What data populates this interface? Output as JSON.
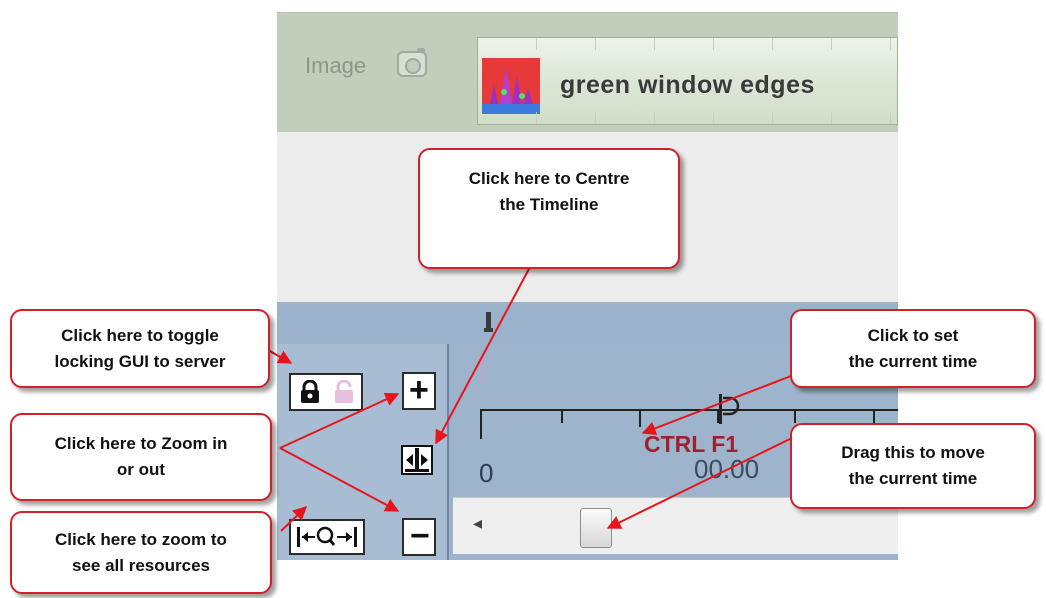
{
  "track": {
    "label": "Image",
    "camera_icon": "camera-icon",
    "clip_title": "green window edges"
  },
  "timeline": {
    "zero_label": "0",
    "current_time_label": "CTRL F1",
    "timecode": "00.00"
  },
  "controls": {
    "lock_icon": "padlock-icon",
    "unlock_icon": "unlocked-padlock-icon",
    "zoom_in_symbol": "+",
    "zoom_out_symbol": "−",
    "centre_icon": "centre-timeline-icon",
    "zoom_all_icon": "zoom-all-icon",
    "scroll_left_symbol": "◂"
  },
  "callouts": {
    "centre": "Click here to Centre\nthe Timeline",
    "lock": "Click here to toggle\nlocking GUI to server",
    "zoom": "Click here to Zoom in\nor out",
    "zoom_all": "Click here to zoom to\nsee all resources",
    "set_time": "Click to set\nthe current time",
    "drag_time": "Drag this to move\nthe current time"
  },
  "colors": {
    "callout_border": "#d0202a",
    "arrow": "#e8141c",
    "track_bg": "#c2cdbb",
    "timeline_bg": "#9eb4cc",
    "current_time_text": "#9b2330"
  }
}
